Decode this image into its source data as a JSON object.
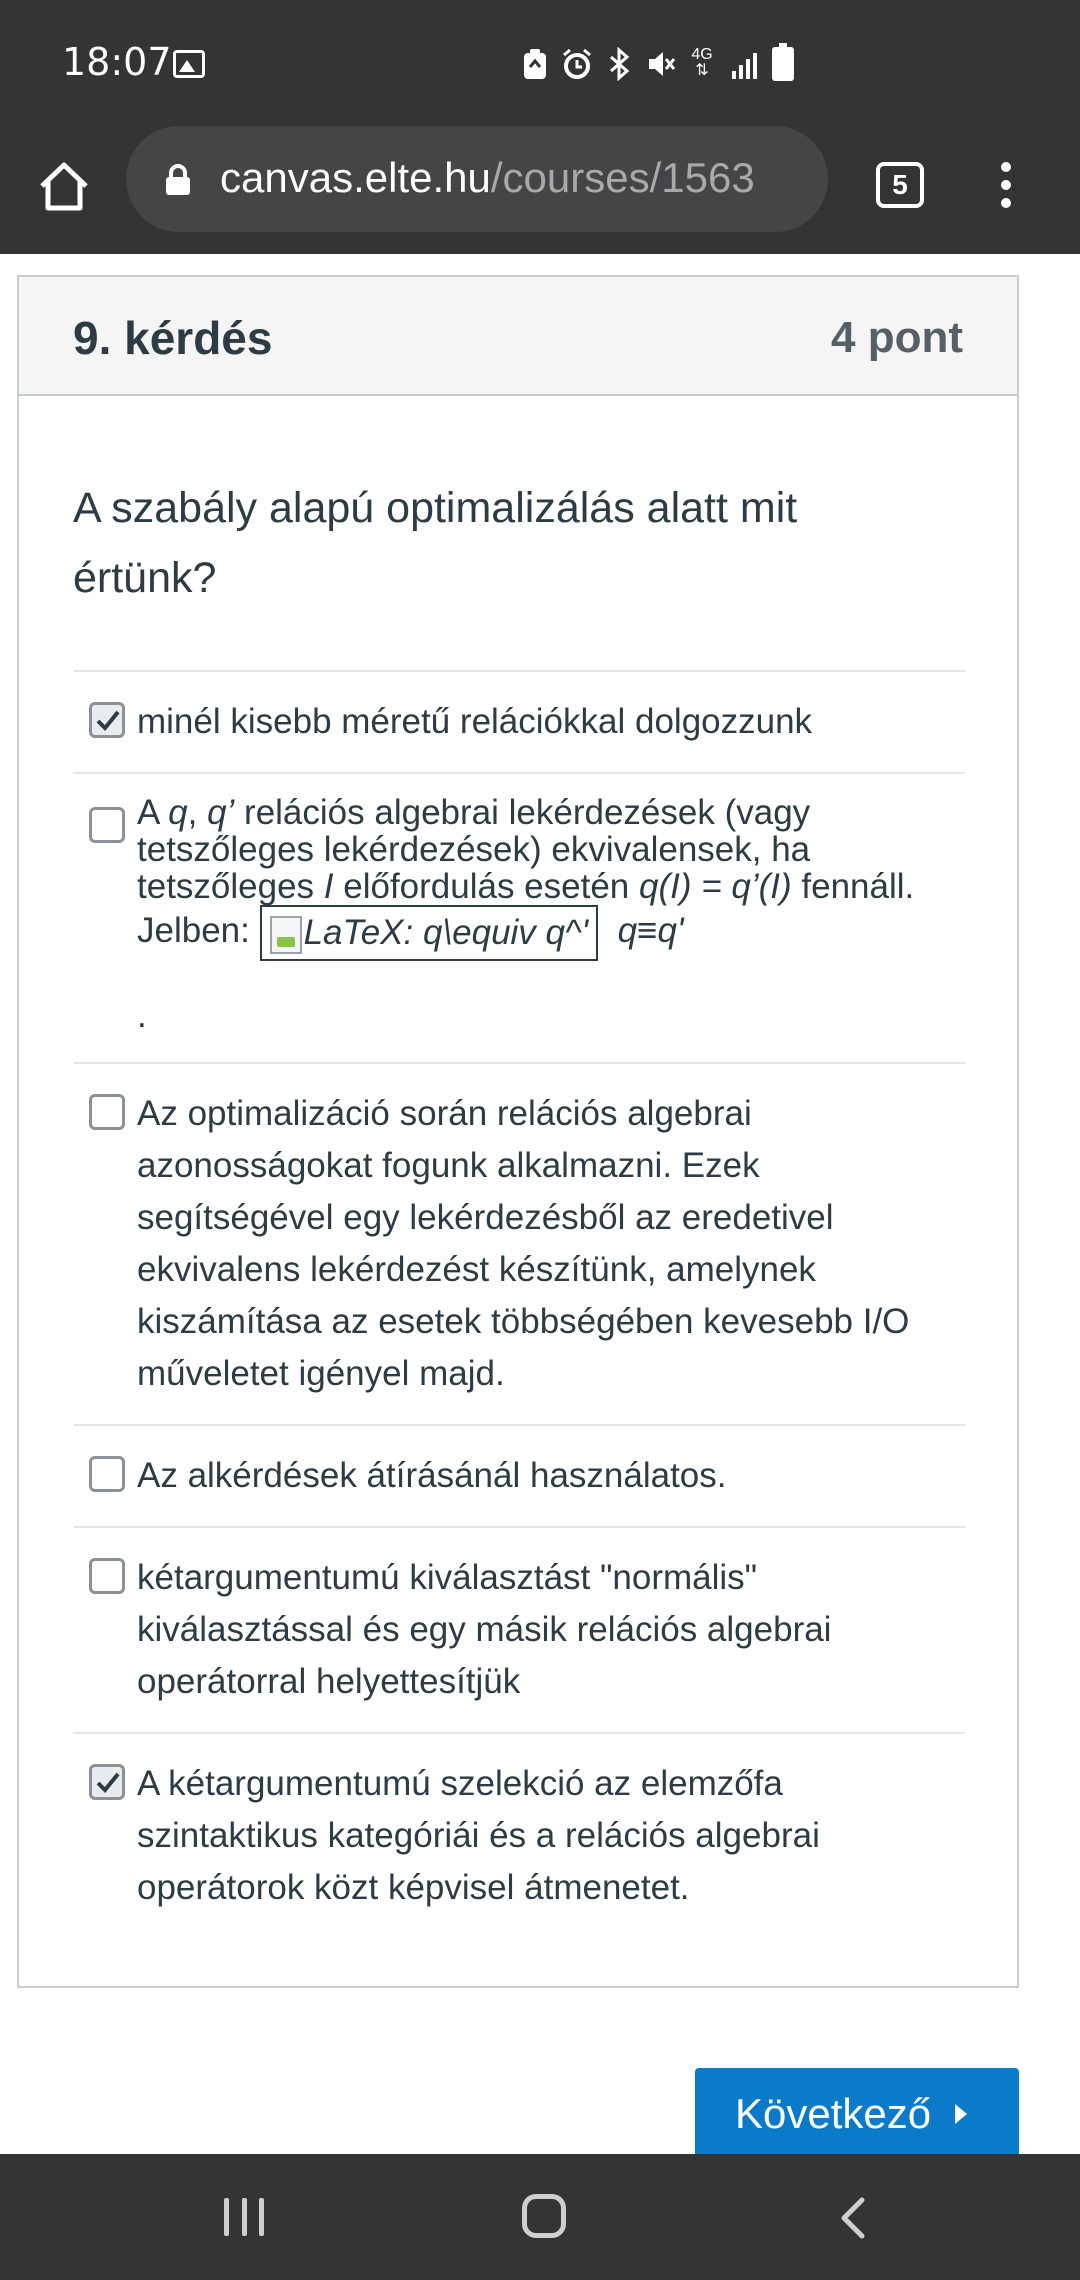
{
  "status": {
    "time": "18:07",
    "icons": [
      "gallery-icon",
      "recycle-icon",
      "alarm-icon",
      "bluetooth-icon",
      "mute-icon",
      "network-4g-icon",
      "signal-icon",
      "battery-icon"
    ],
    "network_label": "4G"
  },
  "browser": {
    "url_host": "canvas.elte.hu",
    "url_path": "/courses/1563",
    "tab_count": "5"
  },
  "question": {
    "title": "9. kérdés",
    "points": "4 pont",
    "text": "A szabály alapú optimalizálás alatt mit értünk?",
    "answers": [
      {
        "checked": true,
        "text": "minél kisebb méretű relációkkal dolgozzunk"
      },
      {
        "checked": false,
        "parts": {
          "a1": "A ",
          "q1": "q",
          "a2": ", ",
          "q2": "q’",
          "a3": " relációs algebrai lekérdezések (vagy tetszőleges lekérdezések) ekvivalensek, ha tetszőleges ",
          "i1": "I",
          "a4": " előfordulás esetén ",
          "f1": "q(I) = q’(I)",
          "a5": " fennáll. Jelben: ",
          "latex": "LaTeX: q\\equiv q^'",
          "equiv": "q≡q'",
          "dot": "."
        }
      },
      {
        "checked": false,
        "text": "Az optimalizáció során relációs algebrai azonosságokat fogunk alkalmazni. Ezek segítségével egy lekérdezésből az eredetivel ekvivalens lekérdezést készítünk, amelynek kiszámítása az esetek többségében kevesebb I/O műveletet igényel majd."
      },
      {
        "checked": false,
        "text": "Az alkérdések átírásánál használatos."
      },
      {
        "checked": false,
        "text": "kétargumentumú kiválasztást \"normális\" kiválasztással és egy másik relációs algebrai operátorral helyettesítjük"
      },
      {
        "checked": true,
        "text": "A kétargumentumú szelekció az elemzőfa szintaktikus kategóriái és a relációs algebrai operátorok közt képvisel átmenetet."
      }
    ],
    "next_label": "Következő"
  },
  "colors": {
    "system_bar": "#333435",
    "url_pill": "#434547",
    "header_bg": "#f5f5f5",
    "border": "#c7cdd1",
    "text": "#2d3b45",
    "next_button": "#0b7bc9"
  }
}
